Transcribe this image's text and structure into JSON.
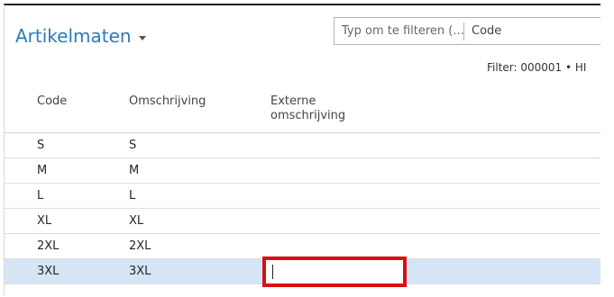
{
  "header": {
    "title": "Artikelmaten",
    "search_placeholder": "Typ om te filteren (...",
    "search_field": "Code",
    "filter": "Filter: 000001 • HI"
  },
  "columns": {
    "code": "Code",
    "description": "Omschrijving",
    "external_line1": "Externe",
    "external_line2": "omschrijving"
  },
  "rows": [
    {
      "code": "S",
      "description": "S",
      "external": ""
    },
    {
      "code": "M",
      "description": "M",
      "external": ""
    },
    {
      "code": "L",
      "description": "L",
      "external": ""
    },
    {
      "code": "XL",
      "description": "XL",
      "external": ""
    },
    {
      "code": "2XL",
      "description": "2XL",
      "external": ""
    },
    {
      "code": "3XL",
      "description": "3XL",
      "external": ""
    }
  ],
  "selected_row": "3XL",
  "colors": {
    "title": "#2b7bbd",
    "selected_row": "#d4e5f5",
    "highlight_box": "#d81010"
  }
}
